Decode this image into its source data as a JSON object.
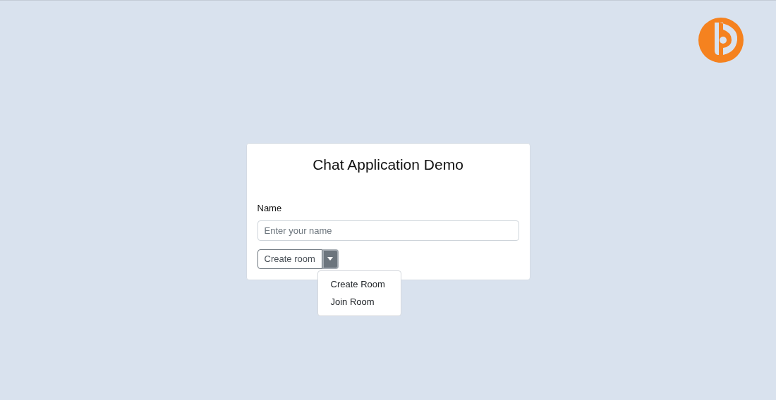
{
  "card": {
    "title": "Chat Application Demo"
  },
  "name_field": {
    "label": "Name",
    "placeholder": "Enter your name"
  },
  "room_button": {
    "label": "Create room",
    "expanded": true
  },
  "menu": [
    {
      "label": "Create Room"
    },
    {
      "label": "Join Room"
    }
  ]
}
